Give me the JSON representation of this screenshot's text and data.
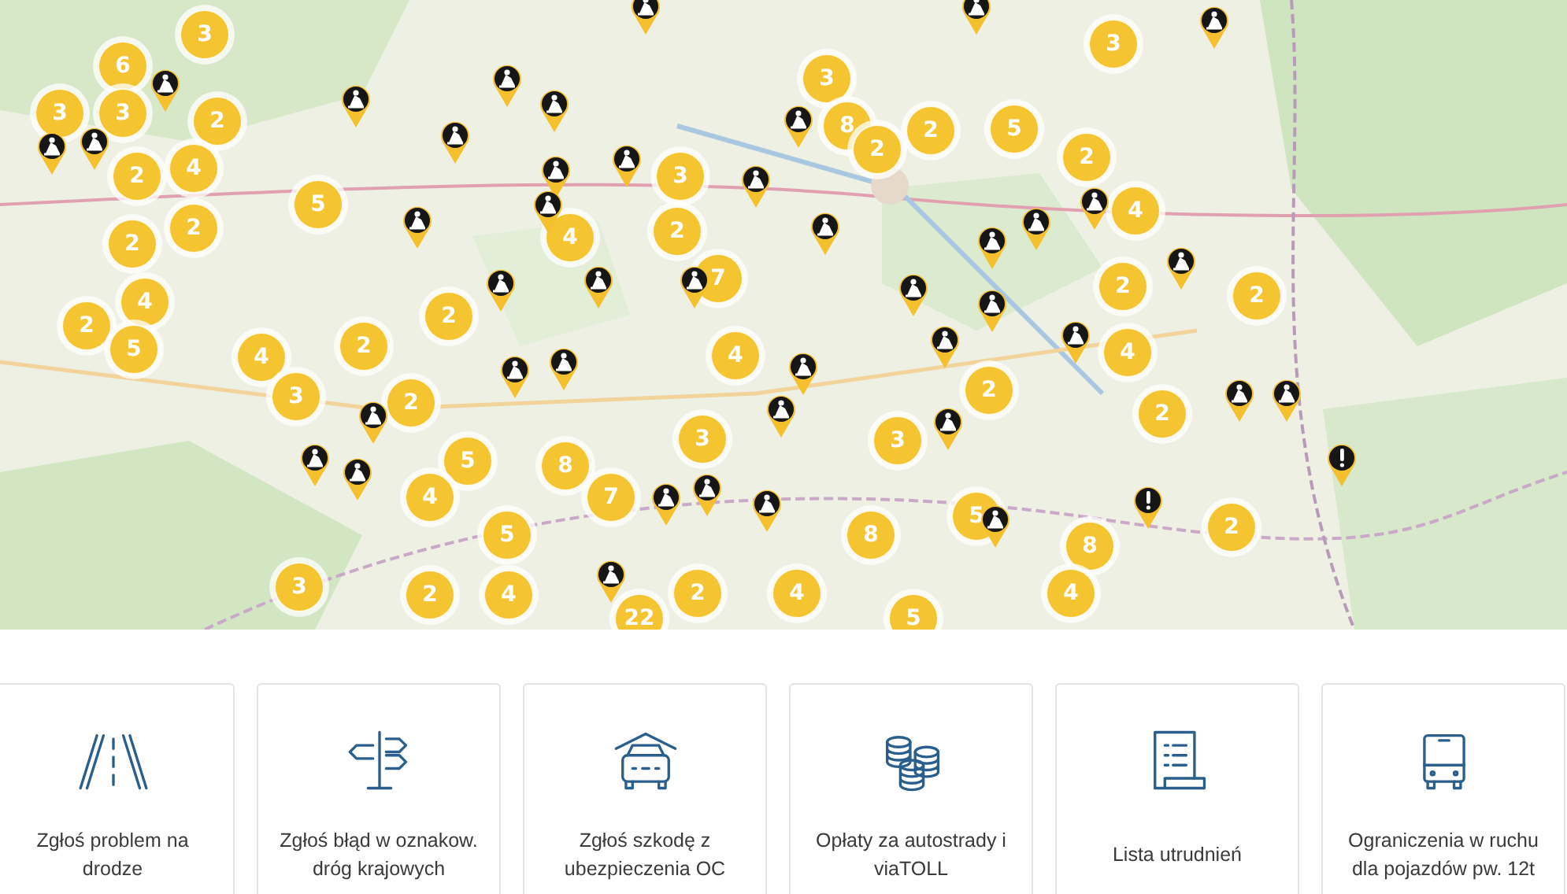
{
  "map": {
    "clusters": [
      {
        "count": "3"
      },
      {
        "count": "6"
      },
      {
        "count": "3"
      },
      {
        "count": "3"
      },
      {
        "count": "2"
      },
      {
        "count": "2"
      },
      {
        "count": "4"
      },
      {
        "count": "5"
      },
      {
        "count": "2"
      },
      {
        "count": "2"
      },
      {
        "count": "4"
      },
      {
        "count": "2"
      },
      {
        "count": "5"
      },
      {
        "count": "4"
      },
      {
        "count": "3"
      },
      {
        "count": "2"
      },
      {
        "count": "2"
      },
      {
        "count": "2"
      },
      {
        "count": "5"
      },
      {
        "count": "4"
      },
      {
        "count": "8"
      },
      {
        "count": "7"
      },
      {
        "count": "5"
      },
      {
        "count": "3"
      },
      {
        "count": "2"
      },
      {
        "count": "4"
      },
      {
        "count": "22"
      },
      {
        "count": "2"
      },
      {
        "count": "4"
      },
      {
        "count": "5"
      },
      {
        "count": "8"
      },
      {
        "count": "5"
      },
      {
        "count": "8"
      },
      {
        "count": "4"
      },
      {
        "count": "2"
      },
      {
        "count": "2"
      },
      {
        "count": "2"
      },
      {
        "count": "3"
      },
      {
        "count": "3"
      },
      {
        "count": "4"
      },
      {
        "count": "7"
      },
      {
        "count": "2"
      },
      {
        "count": "3"
      },
      {
        "count": "4"
      },
      {
        "count": "3"
      },
      {
        "count": "8"
      },
      {
        "count": "2"
      },
      {
        "count": "2"
      },
      {
        "count": "5"
      },
      {
        "count": "3"
      },
      {
        "count": "2"
      },
      {
        "count": "4"
      },
      {
        "count": "2"
      },
      {
        "count": "4"
      },
      {
        "count": "2"
      }
    ],
    "pins": [
      {
        "kind": "roadwork"
      },
      {
        "kind": "roadwork"
      },
      {
        "kind": "roadwork"
      },
      {
        "kind": "roadwork"
      },
      {
        "kind": "roadwork"
      },
      {
        "kind": "roadwork"
      },
      {
        "kind": "roadwork"
      },
      {
        "kind": "roadwork"
      },
      {
        "kind": "roadwork"
      },
      {
        "kind": "roadwork"
      },
      {
        "kind": "roadwork"
      },
      {
        "kind": "roadwork"
      },
      {
        "kind": "roadwork"
      },
      {
        "kind": "roadwork"
      },
      {
        "kind": "roadwork"
      },
      {
        "kind": "roadwork"
      },
      {
        "kind": "roadwork"
      },
      {
        "kind": "roadwork"
      },
      {
        "kind": "roadwork"
      },
      {
        "kind": "roadwork"
      },
      {
        "kind": "roadwork"
      },
      {
        "kind": "roadwork"
      },
      {
        "kind": "roadwork"
      },
      {
        "kind": "roadwork"
      },
      {
        "kind": "roadwork"
      },
      {
        "kind": "roadwork"
      },
      {
        "kind": "roadwork"
      },
      {
        "kind": "roadwork"
      },
      {
        "kind": "roadwork"
      },
      {
        "kind": "alert"
      },
      {
        "kind": "alert"
      },
      {
        "kind": "roadwork"
      },
      {
        "kind": "roadwork"
      },
      {
        "kind": "roadwork"
      },
      {
        "kind": "roadwork"
      },
      {
        "kind": "roadwork"
      },
      {
        "kind": "roadwork"
      },
      {
        "kind": "roadwork"
      },
      {
        "kind": "roadwork"
      },
      {
        "kind": "roadwork"
      },
      {
        "kind": "roadwork"
      },
      {
        "kind": "roadwork"
      },
      {
        "kind": "roadwork"
      },
      {
        "kind": "roadwork"
      },
      {
        "kind": "roadwork"
      }
    ]
  },
  "cards": [
    {
      "label": "Zgłoś problem na drodze"
    },
    {
      "label": "Zgłoś błąd w oznakow. dróg krajowych"
    },
    {
      "label": "Zgłoś szkodę z ubezpieczenia OC"
    },
    {
      "label": "Opłaty za autostrady i viaTOLL"
    },
    {
      "label": "Lista utrudnień"
    },
    {
      "label": "Ograniczenia w ruchu dla pojazdów pw. 12t"
    }
  ]
}
